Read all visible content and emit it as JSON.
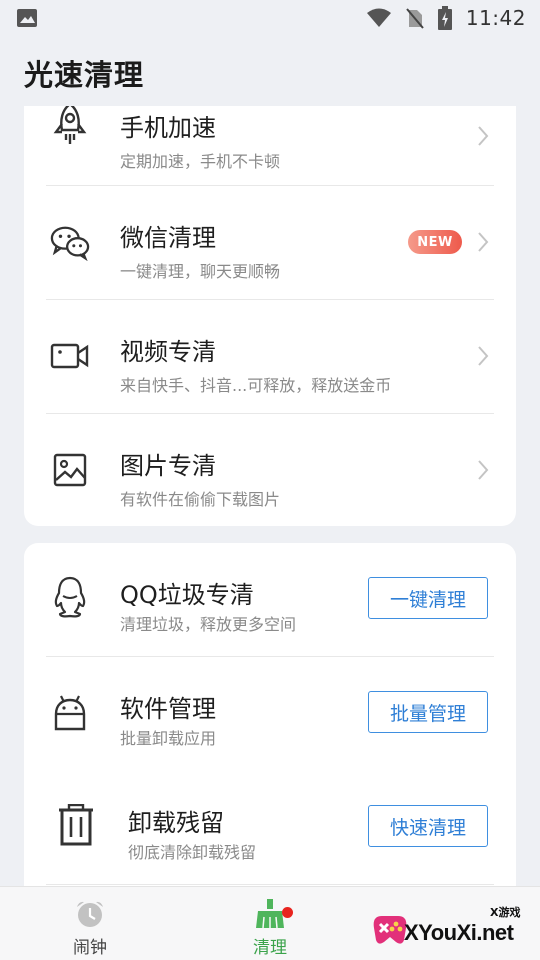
{
  "status_bar": {
    "time": "11:42",
    "icons": [
      "image-icon",
      "wifi-icon",
      "no-sim-icon",
      "battery-charging-icon"
    ]
  },
  "app": {
    "title": "光速清理"
  },
  "feature_list": [
    {
      "icon": "rocket-icon",
      "title": "手机加速",
      "subtitle": "定期加速，手机不卡顿"
    },
    {
      "icon": "wechat-icon",
      "title": "微信清理",
      "subtitle": "一键清理，聊天更顺畅",
      "badge": "NEW"
    },
    {
      "icon": "video-camera-icon",
      "title": "视频专清",
      "subtitle": "来自快手、抖音...可释放，释放送金币"
    },
    {
      "icon": "image-icon",
      "title": "图片专清",
      "subtitle": "有软件在偷偷下载图片"
    }
  ],
  "tool_list": [
    {
      "icon": "qq-penguin-icon",
      "title": "QQ垃圾专清",
      "subtitle": "清理垃圾，释放更多空间",
      "button": "一键清理"
    },
    {
      "icon": "android-icon",
      "title": "软件管理",
      "subtitle": "批量卸载应用",
      "button": "批量管理"
    },
    {
      "icon": "trash-icon",
      "title": "卸载残留",
      "subtitle": "彻底清除卸载残留",
      "button": "快速清理"
    }
  ],
  "bottom_nav": {
    "items": [
      {
        "label": "闹钟",
        "icon": "alarm-clock-icon",
        "active": false
      },
      {
        "label": "清理",
        "icon": "broom-icon",
        "active": true,
        "dot": true
      }
    ]
  },
  "watermark": {
    "text": "XYouXi.net",
    "small": "X游戏"
  },
  "colors": {
    "accent_blue": "#2f7fd6",
    "active_green": "#3ba34b",
    "badge_red": "#ee5a4c",
    "notification_dot": "#e8241f"
  }
}
